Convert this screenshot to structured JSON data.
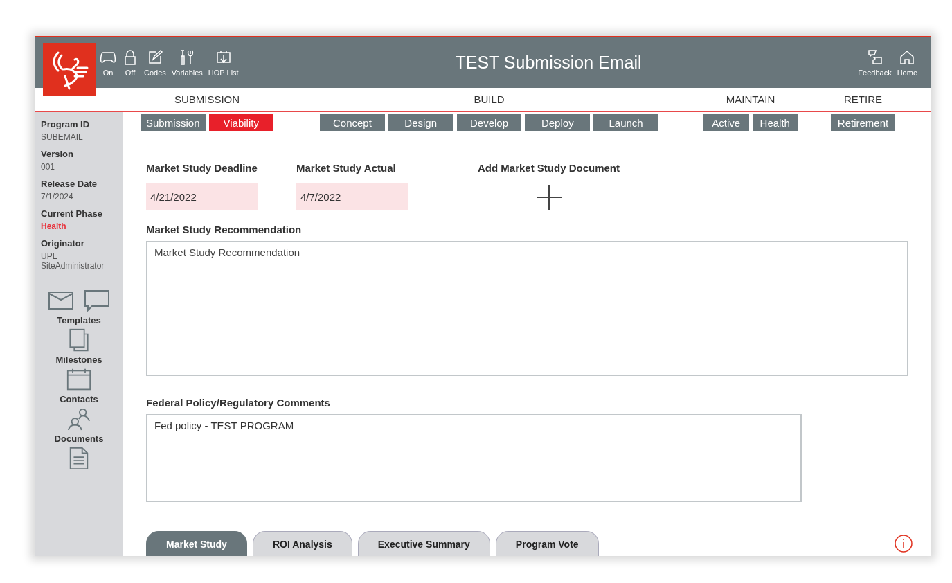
{
  "window": {
    "title": "TEST Submission Email"
  },
  "toolbar": {
    "left": [
      {
        "label": "On"
      },
      {
        "label": "Off"
      },
      {
        "label": "Codes"
      },
      {
        "label": "Variables"
      },
      {
        "label": "HOP List"
      }
    ],
    "right": [
      {
        "label": "Feedback"
      },
      {
        "label": "Home"
      }
    ]
  },
  "phases": [
    {
      "label": "SUBMISSION",
      "steps": [
        {
          "label": "Submission",
          "selected": false
        },
        {
          "label": "Viability",
          "selected": true
        }
      ]
    },
    {
      "label": "BUILD",
      "steps": [
        {
          "label": "Concept",
          "selected": false
        },
        {
          "label": "Design",
          "selected": false
        },
        {
          "label": "Develop",
          "selected": false
        },
        {
          "label": "Deploy",
          "selected": false
        },
        {
          "label": "Launch",
          "selected": false
        }
      ]
    },
    {
      "label": "MAINTAIN",
      "steps": [
        {
          "label": "Active",
          "selected": false
        },
        {
          "label": "Health",
          "selected": false
        }
      ]
    },
    {
      "label": "RETIRE",
      "steps": [
        {
          "label": "Retirement",
          "selected": false
        }
      ]
    }
  ],
  "sidebar": {
    "info": [
      {
        "label": "Program ID",
        "value": "SUBEMAIL",
        "highlighted": false
      },
      {
        "label": "Version",
        "value": "001",
        "highlighted": false
      },
      {
        "label": "Release Date",
        "value": "7/1/2024",
        "highlighted": false
      },
      {
        "label": "Current Phase",
        "value": "Health",
        "highlighted": true
      },
      {
        "label": "Originator",
        "value": "UPL SiteAdministrator",
        "highlighted": false
      }
    ],
    "nav": [
      {
        "label": "Templates"
      },
      {
        "label": "Milestones"
      },
      {
        "label": "Contacts"
      },
      {
        "label": "Documents"
      }
    ]
  },
  "form": {
    "dates": [
      {
        "label": "Market Study Deadline",
        "value": "4/21/2022"
      },
      {
        "label": "Market Study Actual",
        "value": "4/7/2022"
      }
    ],
    "add_document": {
      "label": "Add Market Study Document"
    },
    "recommendation": {
      "label": "Market Study Recommendation",
      "placeholder": "Market Study Recommendation"
    },
    "comments": {
      "label": "Federal Policy/Regulatory Comments",
      "value": "Fed policy - TEST PROGRAM"
    }
  },
  "bottom_tabs": [
    {
      "label": "Market Study",
      "selected": true
    },
    {
      "label": "ROI Analysis",
      "selected": false
    },
    {
      "label": "Executive Summary",
      "selected": false
    },
    {
      "label": "Program Vote",
      "selected": false
    }
  ]
}
